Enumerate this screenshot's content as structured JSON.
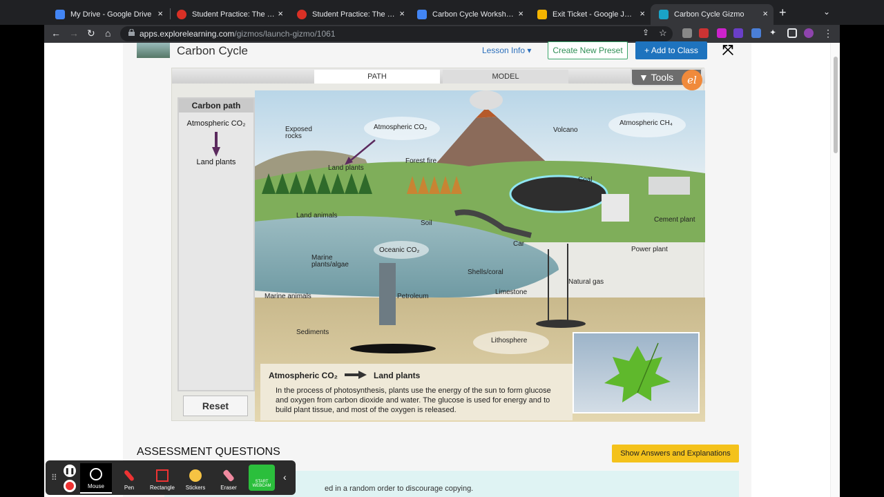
{
  "browser": {
    "tabs": [
      {
        "title": "My Drive - Google Drive",
        "icon_color": "#4285f4"
      },
      {
        "title": "Student Practice: The Carbon",
        "icon_color": "#d93025"
      },
      {
        "title": "Student Practice: The Carbon",
        "icon_color": "#d93025"
      },
      {
        "title": "Carbon Cycle Worksheet D",
        "icon_color": "#4285f4"
      },
      {
        "title": "Exit Ticket - Google Jamboard",
        "icon_color": "#f4b400"
      },
      {
        "title": "Carbon Cycle Gizmo",
        "icon_color": "#1aa3c7"
      }
    ],
    "url_host": "apps.explorelearning.com",
    "url_path": "/gizmos/launch-gizmo/1061",
    "new_tab": "+",
    "close_glyph": "×"
  },
  "header": {
    "title": "Carbon Cycle",
    "lesson_info": "Lesson Info ▾",
    "create_preset": "Create New Preset",
    "add_to_class": "+ Add to Class",
    "expand_glyph": "⤧"
  },
  "gizmo": {
    "tab_path": "PATH",
    "tab_model": "MODEL",
    "tools": "▼ Tools",
    "logo": "el",
    "carbon_path": {
      "heading": "Carbon path",
      "from": "Atmospheric CO₂",
      "to": "Land plants"
    },
    "reset": "Reset",
    "scene_labels": {
      "exposed_rocks": "Exposed rocks",
      "atmospheric_co2": "Atmospheric CO₂",
      "volcano": "Volcano",
      "atmospheric_ch4": "Atmospheric CH₄",
      "land_plants": "Land plants",
      "forest_fire": "Forest fire",
      "coal": "Coal",
      "land_animals": "Land animals",
      "soil": "Soil",
      "cement_plant": "Cement plant",
      "car": "Car",
      "oceanic_co2": "Oceanic CO₂",
      "power_plant": "Power plant",
      "marine_plants": "Marine plants/algae",
      "shells_coral": "Shells/coral",
      "natural_gas": "Natural gas",
      "limestone": "Limestone",
      "marine_animals": "Marine animals",
      "petroleum": "Petroleum",
      "sediments": "Sediments",
      "lithosphere": "Lithosphere"
    },
    "info": {
      "from": "Atmospheric CO₂",
      "to": "Land plants",
      "text": "In the process of photosynthesis, plants use the energy of the sun to form glucose and oxygen from carbon dioxide and water. The glucose is used for energy and to build plant tissue, and most of the oxygen is released."
    }
  },
  "assessment": {
    "heading": "ASSESSMENT QUESTIONS",
    "show_button": "Show Answers and Explanations",
    "notice": "ed in a random order to discourage copying."
  },
  "annotation_toolbar": {
    "tools": [
      "Mouse",
      "Pen",
      "Rectangle",
      "Stickers",
      "Eraser"
    ],
    "webcam": "START WEBCAM",
    "pause_glyph": "❚❚",
    "collapse_glyph": "‹"
  },
  "colors": {
    "accent_blue": "#1e73be",
    "preset_green": "#3aa66a",
    "show_yellow": "#f4c21b",
    "path_arrow": "#5b2a5e"
  }
}
